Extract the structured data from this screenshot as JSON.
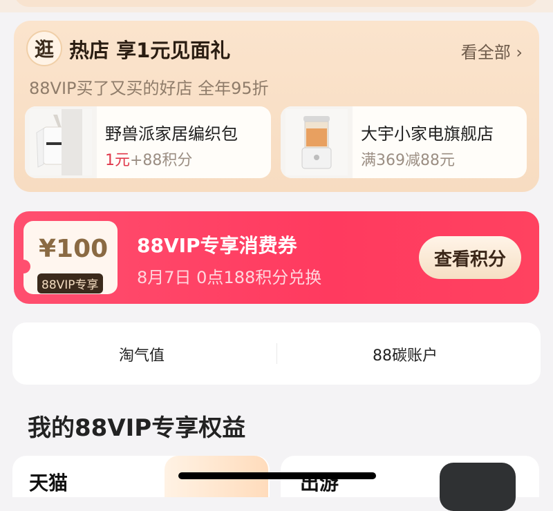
{
  "hot_shops": {
    "badge_text": "逛",
    "title": "热店 享1元见面礼",
    "see_all": "看全部 ›",
    "subtitle": "88VIP买了又买的好店 全年95折",
    "items": [
      {
        "name": "野兽派家居编织包",
        "offer_red": "1元",
        "offer_rest": "+88积分"
      },
      {
        "name": "大宇小家电旗舰店",
        "offer_red": "",
        "offer_rest": "满369减88元"
      }
    ]
  },
  "coupon": {
    "amount": "¥100",
    "tag": "88VIP专享",
    "title": "88VIP专享消费券",
    "subtitle": "8月7日 0点188积分兑换",
    "button": "查看积分"
  },
  "value_bar": {
    "left": "淘气值",
    "right": "88碳账户"
  },
  "section_title": "我的88VIP专享权益",
  "bottom_cards": {
    "left_label": "天猫",
    "right_label": "出游"
  }
}
